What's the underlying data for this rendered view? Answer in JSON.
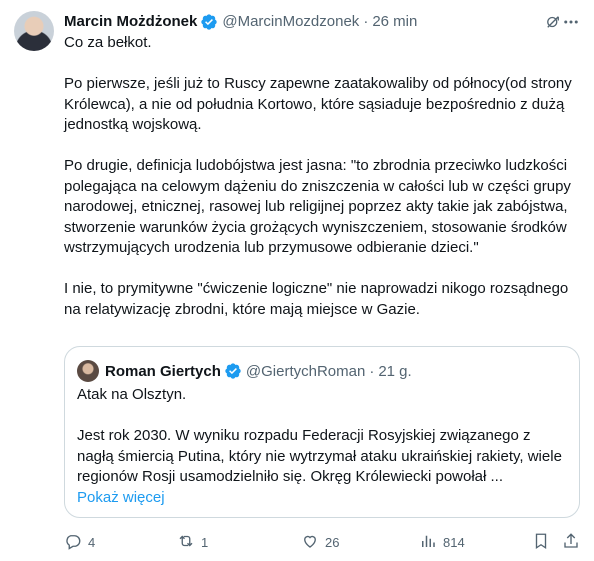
{
  "author": {
    "name": "Marcin Możdżonek",
    "handle": "@MarcinMozdzonek",
    "separator": "·",
    "time": "26 min"
  },
  "tweet": {
    "paragraphs": [
      "Co za bełkot.",
      "Po pierwsze, jeśli już to Ruscy zapewne zaatakowaliby od północy(od strony Królewca), a nie od południa Kortowo, które sąsiaduje bezpośrednio z dużą jednostką wojskową.",
      "Po drugie, definicja ludobójstwa jest jasna: \"to zbrodnia przeciwko ludzkości polegająca na celowym dążeniu do zniszczenia w całości lub w części grupy narodowej, etnicznej, rasowej lub religijnej poprzez akty takie jak zabójstwa, stworzenie warunków życia grożących wyniszczeniem, stosowanie środków wstrzymujących urodzenia lub przymusowe odbieranie dzieci.\"",
      "I nie, to prymitywne \"ćwiczenie logiczne\" nie naprowadzi nikogo rozsądnego na relatywizację zbrodni, które mają miejsce w Gazie."
    ]
  },
  "quote": {
    "name": "Roman Giertych",
    "handle": "@GiertychRoman",
    "separator": "·",
    "time": "21 g.",
    "paragraphs": [
      "Atak na Olsztyn.",
      "Jest rok 2030. W wyniku rozpadu Federacji Rosyjskiej związanego z nagłą śmiercią Putina, który nie wytrzymał ataku ukraińskiej rakiety, wiele regionów Rosji usamodzielniło się. Okręg Królewiecki powołał ..."
    ],
    "show_more": "Pokaż więcej"
  },
  "actions": {
    "replies": "4",
    "reposts": "1",
    "likes": "26",
    "views": "814"
  },
  "colors": {
    "accent": "#1d9bf0",
    "text": "#0f1419",
    "muted": "#536471",
    "border": "#cfd9de"
  },
  "icons": [
    "verified-badge-icon",
    "grok-icon",
    "more-icon",
    "reply-icon",
    "repost-icon",
    "like-icon",
    "views-icon",
    "bookmark-icon",
    "share-icon"
  ]
}
